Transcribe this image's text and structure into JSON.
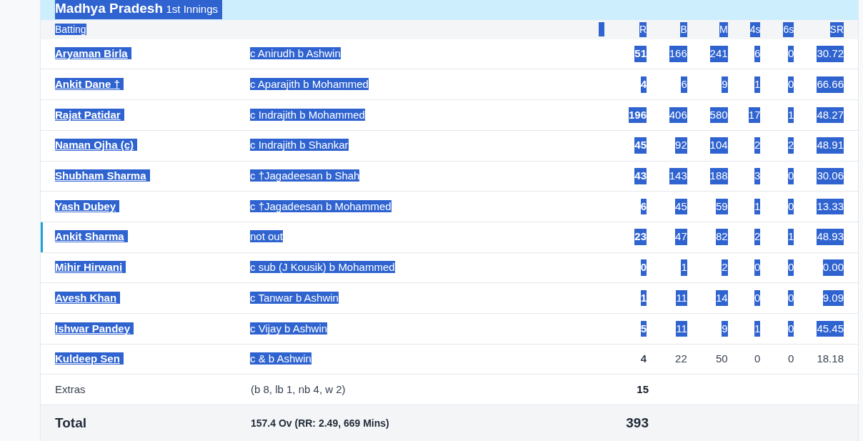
{
  "innings": {
    "team": "Madhya Pradesh",
    "label": "1st Innings",
    "selected": true
  },
  "header": {
    "label": "Batting",
    "selected": true,
    "blank_selected": true,
    "columns": [
      {
        "label": "R",
        "selected": true
      },
      {
        "label": "B",
        "selected": true
      },
      {
        "label": "M",
        "selected": true
      },
      {
        "label": "4s",
        "selected": true
      },
      {
        "label": "6s",
        "selected": true
      },
      {
        "label": "SR",
        "selected": true
      }
    ]
  },
  "batters": [
    {
      "name": "Aryaman Birla",
      "dismissal": "c Anirudh b Ashwin",
      "stats": [
        "51",
        "166",
        "241",
        "6",
        "0",
        "30.72"
      ],
      "name_selected": true,
      "stats_selected": true,
      "current": false
    },
    {
      "name": "Ankit Dane †",
      "dismissal": "c Aparajith b Mohammed",
      "stats": [
        "4",
        "6",
        "9",
        "1",
        "0",
        "66.66"
      ],
      "name_selected": true,
      "stats_selected": true,
      "current": false
    },
    {
      "name": "Rajat Patidar",
      "dismissal": "c Indrajith b Mohammed",
      "stats": [
        "196",
        "406",
        "580",
        "17",
        "1",
        "48.27"
      ],
      "name_selected": true,
      "stats_selected": true,
      "current": false
    },
    {
      "name": "Naman Ojha (c)",
      "dismissal": "c Indrajith b Shankar",
      "stats": [
        "45",
        "92",
        "104",
        "2",
        "2",
        "48.91"
      ],
      "name_selected": true,
      "stats_selected": true,
      "current": false
    },
    {
      "name": "Shubham Sharma",
      "dismissal": "c †Jagadeesan b Shah",
      "stats": [
        "43",
        "143",
        "188",
        "3",
        "0",
        "30.06"
      ],
      "name_selected": true,
      "stats_selected": true,
      "current": false
    },
    {
      "name": "Yash Dubey",
      "dismissal": "c †Jagadeesan b Mohammed",
      "stats": [
        "6",
        "45",
        "59",
        "1",
        "0",
        "13.33"
      ],
      "name_selected": true,
      "stats_selected": true,
      "current": false
    },
    {
      "name": "Ankit Sharma",
      "dismissal": "not out",
      "stats": [
        "23",
        "47",
        "82",
        "2",
        "1",
        "48.93"
      ],
      "name_selected": true,
      "stats_selected": true,
      "current": true
    },
    {
      "name": "Mihir Hirwani",
      "dismissal": "c sub (J Kousik) b Mohammed",
      "stats": [
        "0",
        "1",
        "2",
        "0",
        "0",
        "0.00"
      ],
      "name_selected": true,
      "stats_selected": true,
      "current": false
    },
    {
      "name": "Avesh Khan",
      "dismissal": "c Tanwar b Ashwin",
      "stats": [
        "1",
        "11",
        "14",
        "0",
        "0",
        "9.09"
      ],
      "name_selected": true,
      "stats_selected": true,
      "current": false
    },
    {
      "name": "Ishwar Pandey",
      "dismissal": "c Vijay b Ashwin",
      "stats": [
        "5",
        "11",
        "9",
        "1",
        "0",
        "45.45"
      ],
      "name_selected": true,
      "stats_selected": true,
      "current": false
    },
    {
      "name": "Kuldeep Sen",
      "dismissal": "c & b Ashwin",
      "stats": [
        "4",
        "22",
        "50",
        "0",
        "0",
        "18.18"
      ],
      "name_selected": true,
      "stats_selected": false,
      "current": false
    }
  ],
  "extras": {
    "label": "Extras",
    "detail": "(b 8, lb 1, nb 4, w 2)",
    "runs": "15"
  },
  "total": {
    "label": "Total",
    "detail": "157.4 Ov (RR: 2.49, 669 Mins)",
    "runs": "393"
  }
}
